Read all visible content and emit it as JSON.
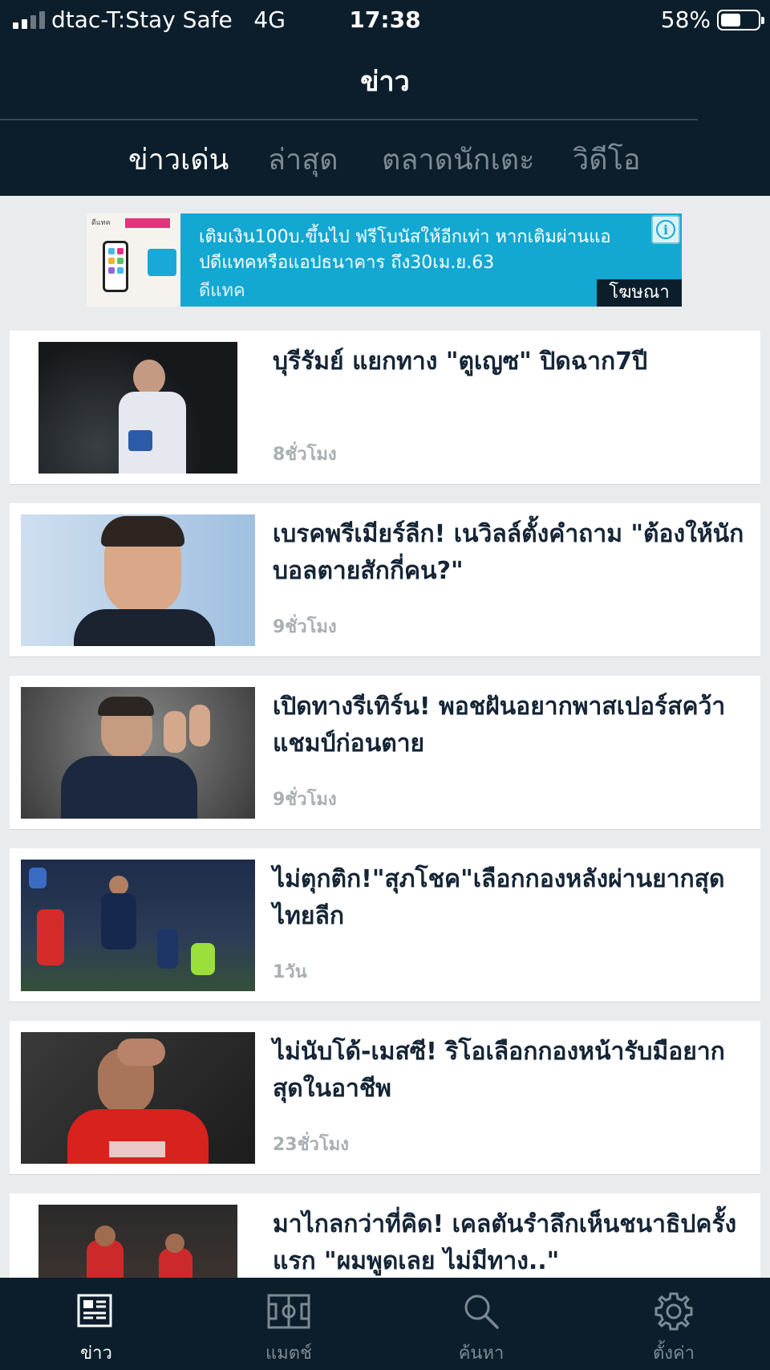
{
  "status_bar": {
    "carrier": "dtac-T:Stay Safe",
    "network": "4G",
    "time": "17:38",
    "battery": "58%"
  },
  "header": {
    "title": "ข่าว",
    "tabs": [
      {
        "label": "ข่าวเด่น",
        "active": true
      },
      {
        "label": "ล่าสุด",
        "active": false
      },
      {
        "label": "ตลาดนักเตะ",
        "active": false
      },
      {
        "label": "วิดีโอ",
        "active": false
      }
    ]
  },
  "ad": {
    "text": "เติมเงิน100บ.ขึ้นไป ฟรีโบนัสให้อีกเท่า หากเติมผ่านแอปดีแทคหรือแอปธนาคาร ถึง30เม.ย.63",
    "sponsor": "ดีแทค",
    "label": "โฆษณา",
    "info_icon": "info-icon",
    "color": "#13a8d2"
  },
  "news": [
    {
      "headline": "บุรีรัมย์ แยกทาง \"ตูเญซ\" ปิดฉาก7ปี",
      "time": "8ชั่วโมง"
    },
    {
      "headline": "เบรคพรีเมียร์ลีก! เนวิลล์ตั้งคำถาม \"ต้องให้นักบอลตายสักกี่คน?\"",
      "time": "9ชั่วโมง"
    },
    {
      "headline": "เปิดทางรีเทิร์น! พอชฝันอยากพาสเปอร์สคว้าแชมป์ก่อนตาย",
      "time": "9ชั่วโมง"
    },
    {
      "headline": "ไม่ตุกติก!\"สุภโชค\"เลือกกองหลังผ่านยากสุดไทยลีก",
      "time": "1วัน"
    },
    {
      "headline": "ไม่นับโด้-เมสซี! ริโอเลือกกองหน้ารับมือยากสุดในอาชีพ",
      "time": "23ชั่วโมง"
    },
    {
      "headline": "มาไกลกว่าที่คิด! เคลตันรำลึกเห็นชนาธิปครั้งแรก \"ผมพูดเลย ไม่มีทาง..\"",
      "time": ""
    }
  ],
  "bottom_nav": [
    {
      "label": "ข่าว",
      "icon": "newspaper-icon",
      "active": true
    },
    {
      "label": "แมตช์",
      "icon": "pitch-icon",
      "active": false
    },
    {
      "label": "ค้นหา",
      "icon": "search-icon",
      "active": false
    },
    {
      "label": "ตั้งค่า",
      "icon": "gear-icon",
      "active": false
    }
  ],
  "colors": {
    "header_bg": "#0c1e2b",
    "page_bg": "#e9ebec",
    "headline": "#152536",
    "muted": "#7c8a94"
  }
}
